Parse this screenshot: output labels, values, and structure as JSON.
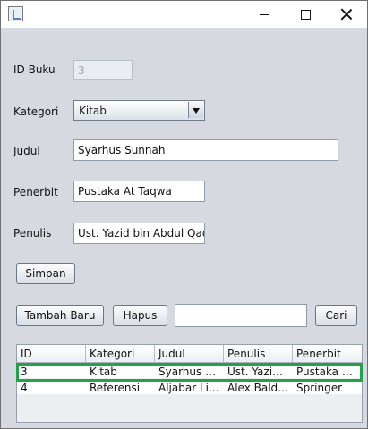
{
  "window": {
    "icon": "java-icon",
    "controls": [
      "minimize-icon",
      "maximize-icon",
      "close-icon"
    ]
  },
  "form": {
    "id_label": "ID Buku",
    "id_value": "3",
    "category_label": "Kategori",
    "category_value": "Kitab",
    "title_label": "Judul",
    "title_value": "Syarhus Sunnah",
    "publisher_label": "Penerbit",
    "publisher_value": "Pustaka At Taqwa",
    "author_label": "Penulis",
    "author_value": "Ust. Yazid bin Abdul Qad"
  },
  "buttons": {
    "save": "Simpan",
    "new": "Tambah Baru",
    "delete": "Hapus",
    "search": "Cari"
  },
  "search": {
    "value": ""
  },
  "table": {
    "columns": [
      "ID",
      "Kategori",
      "Judul",
      "Penulis",
      "Penerbit"
    ],
    "rows": [
      [
        "3",
        "Kitab",
        "Syarhus S...",
        "Ust. Yazid ...",
        "Pustaka At..."
      ],
      [
        "4",
        "Referensi",
        "Aljabar Li...",
        "Alex Bald...",
        "Springer"
      ]
    ]
  },
  "colors": {
    "window_background": "#d6d9df",
    "selection_outline": "#22a24a"
  }
}
